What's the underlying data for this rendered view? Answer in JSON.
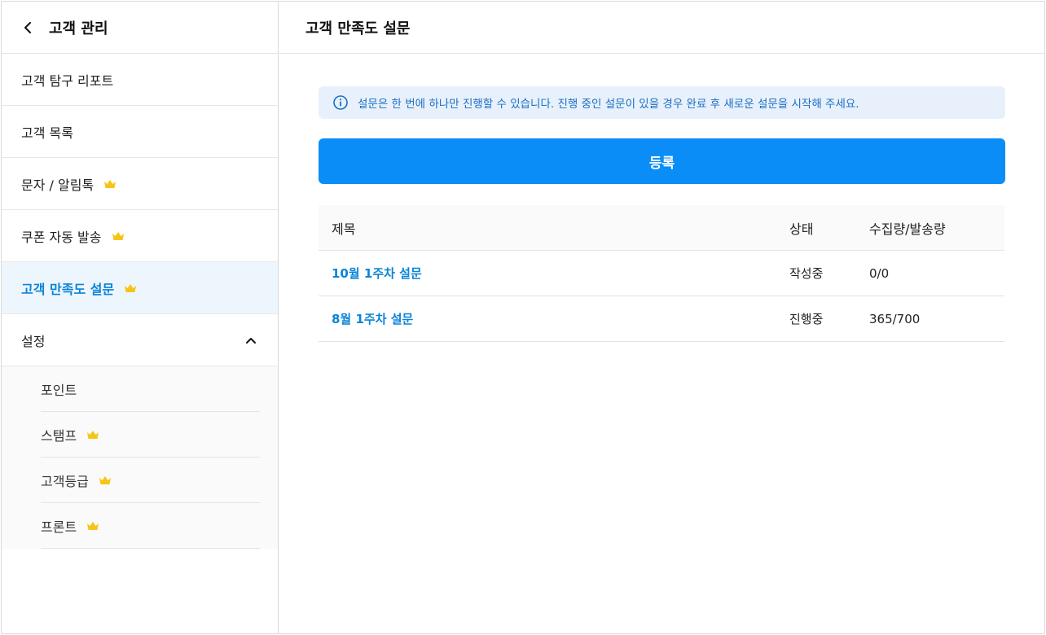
{
  "sidebar": {
    "title": "고객 관리",
    "back_icon": "chevron-left-icon",
    "items": [
      {
        "label": "고객 탐구 리포트",
        "premium": false,
        "active": false
      },
      {
        "label": "고객 목록",
        "premium": false,
        "active": false
      },
      {
        "label": "문자 / 알림톡",
        "premium": true,
        "active": false
      },
      {
        "label": "쿠폰 자동 발송",
        "premium": true,
        "active": false
      },
      {
        "label": "고객 만족도 설문",
        "premium": true,
        "active": true
      }
    ],
    "settings": {
      "label": "설정",
      "expanded": true,
      "items": [
        {
          "label": "포인트",
          "premium": false
        },
        {
          "label": "스탬프",
          "premium": true
        },
        {
          "label": "고객등급",
          "premium": true
        },
        {
          "label": "프론트",
          "premium": true
        }
      ]
    }
  },
  "main": {
    "title": "고객 만족도 설문",
    "notice": "설문은 한 번에 하나만 진행할 수 있습니다. 진행 중인 설문이 있을 경우 완료 후 새로운 설문을 시작해 주세요.",
    "register_label": "등록",
    "table": {
      "columns": [
        "제목",
        "상태",
        "수집량/발송량"
      ],
      "rows": [
        {
          "title": "10월 1주차 설문",
          "status": "작성중",
          "count": "0/0"
        },
        {
          "title": "8월 1주차 설문",
          "status": "진행중",
          "count": "365/700"
        }
      ]
    }
  },
  "colors": {
    "accent": "#0a8df7",
    "active_text": "#0a84d6",
    "active_bg": "#eef6fd",
    "notice_bg": "#e8f1fb",
    "crown": "#f5c518"
  }
}
